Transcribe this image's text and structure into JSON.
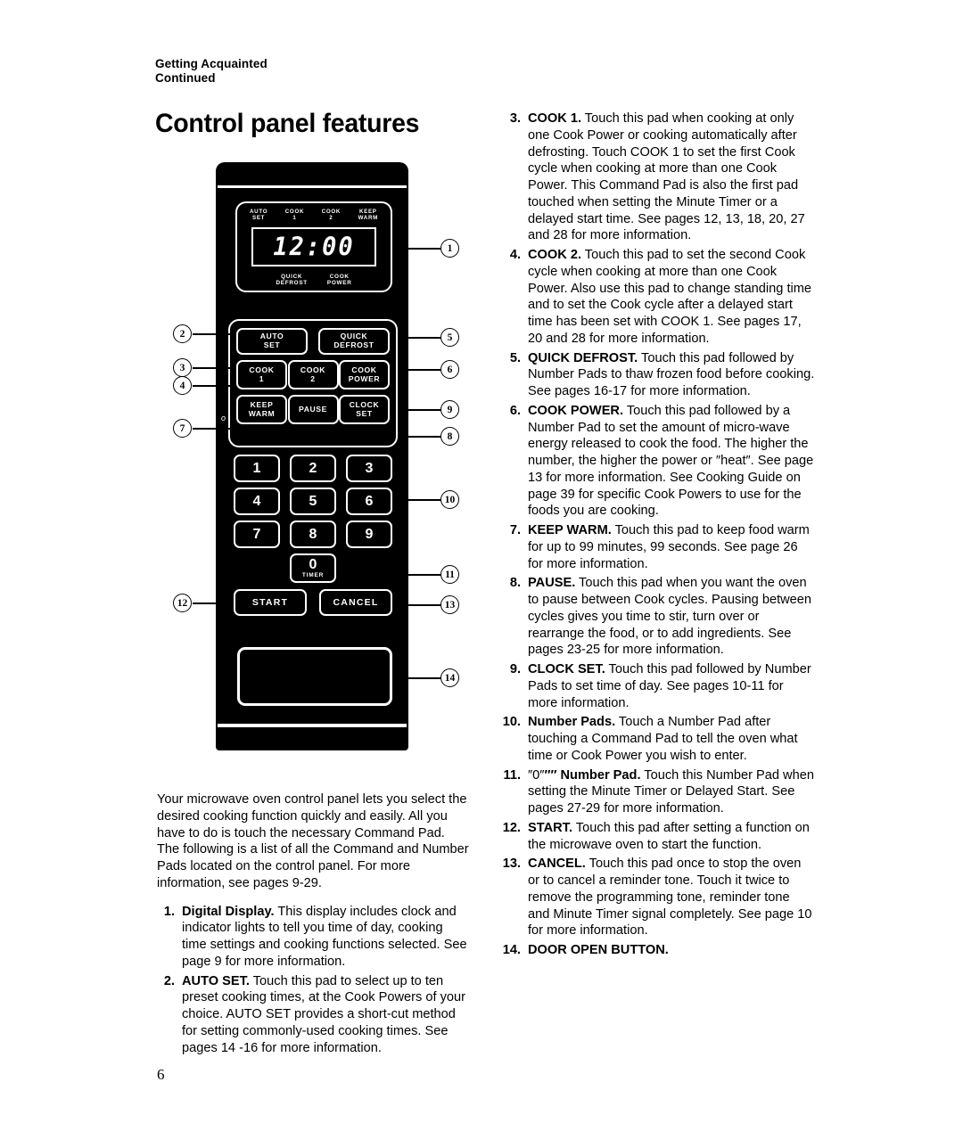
{
  "running_head": {
    "line1": "Getting Acquainted",
    "line2": "Continued"
  },
  "title": "Control panel features",
  "folio": "6",
  "control_panel": {
    "display": {
      "digits": "12:00",
      "top_labels": [
        {
          "line1": "AUTO",
          "line2": "SET"
        },
        {
          "line1": "COOK",
          "line2": "1"
        },
        {
          "line1": "COOK",
          "line2": "2"
        },
        {
          "line1": "KEEP",
          "line2": "WARM"
        }
      ],
      "bottom_labels": [
        {
          "line1": "QUICK",
          "line2": "DEFROST"
        },
        {
          "line1": "COOK",
          "line2": "POWER"
        }
      ]
    },
    "command_pads": [
      [
        {
          "line1": "AUTO",
          "line2": "SET"
        },
        {
          "line1": "QUICK",
          "line2": "DEFROST"
        }
      ],
      [
        {
          "line1": "COOK",
          "line2": "1"
        },
        {
          "line1": "COOK",
          "line2": "2"
        },
        {
          "line1": "COOK",
          "line2": "POWER"
        }
      ],
      [
        {
          "line1": "KEEP",
          "line2": "WARM"
        },
        {
          "line1": "PAUSE",
          "line2": ""
        },
        {
          "line1": "CLOCK",
          "line2": "SET"
        }
      ]
    ],
    "number_pads": [
      [
        "1",
        "2",
        "3"
      ],
      [
        "4",
        "5",
        "6"
      ],
      [
        "7",
        "8",
        "9"
      ]
    ],
    "zero_pad": {
      "digit": "0",
      "sub": "TIMER"
    },
    "action_pads": [
      "START",
      "CANCEL"
    ],
    "callouts": {
      "c1": "1",
      "c2": "2",
      "c3": "3",
      "c4": "4",
      "c5": "5",
      "c6": "6",
      "c7": "7",
      "c8": "8",
      "c9": "9",
      "c10": "10",
      "c11": "11",
      "c12": "12",
      "c13": "13",
      "c14": "14"
    }
  },
  "left_column": {
    "intro": "Your microwave oven control panel lets you select the desired cooking function quickly and easily. All you have to do is touch the necessary Command Pad. The following is a list of all the Command and Number Pads located on the control panel. For more information, see pages 9-29.",
    "items": [
      {
        "num": "1.",
        "lead": "Digital Display.",
        "body": " This display includes clock and indicator lights to tell you time of day, cooking time settings and cooking functions selected. See page 9 for more information."
      },
      {
        "num": "2.",
        "lead": "AUTO SET.",
        "body": " Touch this pad to select up to ten preset cooking times, at the Cook Powers of your choice. AUTO SET provides a short-cut method for setting commonly-used cooking times. See pages 14 -16 for more information."
      }
    ]
  },
  "right_column": {
    "items": [
      {
        "num": "3.",
        "lead": "COOK 1.",
        "body": " Touch this pad when cooking at only one Cook Power or cooking automatically after defrosting. Touch COOK 1 to set the first Cook cycle when cooking at more than one Cook Power. This Command Pad is also the first pad touched when setting the Minute Timer or a delayed start time. See pages 12, 13, 18, 20, 27 and 28 for more information."
      },
      {
        "num": "4.",
        "lead": "COOK 2.",
        "body": " Touch this pad to set the second Cook cycle when cooking at more than one Cook Power. Also use this pad to change standing time and to set the Cook cycle after a delayed start time has been set with COOK 1. See pages 17, 20 and 28 for more information."
      },
      {
        "num": "5.",
        "lead": "QUICK DEFROST.",
        "body": " Touch this pad followed by Number Pads to thaw frozen food before cooking. See pages 16-17 for more information."
      },
      {
        "num": "6.",
        "lead": "COOK POWER.",
        "body": " Touch this pad followed by a Number Pad to set the amount of micro-wave energy released to cook the food. The higher the number, the higher the power or ″heat″. See page 13 for more information. See Cooking Guide on page 39 for specific Cook Powers to use for the foods you are cooking."
      },
      {
        "num": "7.",
        "lead": "KEEP WARM.",
        "body": " Touch this pad to keep food warm for up to 99 minutes, 99 seconds. See page 26 for more information."
      },
      {
        "num": "8.",
        "lead": "PAUSE.",
        "body": " Touch this pad when you want the oven to pause between Cook cycles. Pausing between cycles gives you time to stir, turn over or rearrange the food, or to add ingredients. See pages 23-25 for more information."
      },
      {
        "num": "9.",
        "lead": "CLOCK SET.",
        "body": " Touch this pad followed by Number Pads to set time of day. See pages 10-11 for more information."
      },
      {
        "num": "10.",
        "lead": "Number Pads.",
        "body": " Touch a Number Pad after touching a Command Pad to tell the oven what time or Cook Power you wish to enter."
      },
      {
        "num": "11.",
        "lead": "″″ Number Pad.",
        "body": " Touch this Number Pad when setting the Minute Timer or Delayed Start. See pages 27-29 for more information.",
        "lead_prefix": "″0″"
      },
      {
        "num": "12.",
        "lead": "START.",
        "body": " Touch this pad after setting a function on the microwave oven to start the function."
      },
      {
        "num": "13.",
        "lead": "CANCEL.",
        "body": " Touch this pad once to stop the oven or to cancel a reminder tone. Touch it twice to remove the programming tone, reminder tone and Minute Timer signal completely. See page 10 for more information."
      },
      {
        "num": "14.",
        "lead": "DOOR OPEN BUTTON.",
        "body": ""
      }
    ]
  }
}
